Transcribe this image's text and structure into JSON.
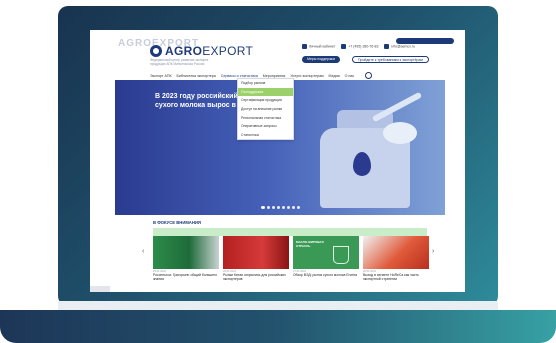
{
  "site": {
    "brand_ghost": "AGROEXPORT",
    "logo_bold": "AGRO",
    "logo_rest": "EXPORT",
    "subtitle": "Федеральный центр развития экспорта продукции АПК Минсельхоза России"
  },
  "header": {
    "cabinet": "Личный кабинет",
    "phone": "+7 (495) 280-76-83",
    "email": "info@aemcx.ru",
    "btn_support": "Меры поддержки",
    "btn_request": "Пройдите к требованиям к экспортёрам"
  },
  "nav": {
    "items": [
      "Экспорт АПК",
      "Библиотека экспортера",
      "Сервисы и статистика",
      "Мероприятия",
      "Услуги экспортерам",
      "Медиа",
      "О нас"
    ],
    "selected_index": 2
  },
  "dropdown": {
    "items": [
      "Подбор рынков",
      "Господдержка",
      "Сертификация продукции",
      "Доступ на внешние рынки",
      "Региональная статистика",
      "Оперативные запросы",
      "Статистика"
    ],
    "active_index": 1
  },
  "hero": {
    "title": "В 2023 году российский экспорт сухого молока вырос в",
    "slides": 8,
    "current_slide": 1
  },
  "focus": {
    "title": "В ФОКУСЕ ВНИМАНИЯ",
    "cards": [
      {
        "date": "29.01.2024",
        "title": "Россельхоз: Григорьев: общий большего знания"
      },
      {
        "date": "29.01.2024",
        "title": "Рынки Китая открылись для российских экспортеров"
      },
      {
        "date": "27.01.2024",
        "title": "Обзор ВЭД: рынок сухого молока Египта",
        "label": "МАСЛО-ЖИРОВАЯ ОТРАСЛЬ"
      },
      {
        "date": "26.01.2024",
        "title": "Выход в сегмент HoReCa как часть экспортной стратегии"
      }
    ]
  },
  "colors": {
    "brand_navy": "#1d3a78",
    "accent_green": "#9bd06b",
    "frame_dark": "#18334f",
    "frame_teal": "#37a1a4"
  }
}
